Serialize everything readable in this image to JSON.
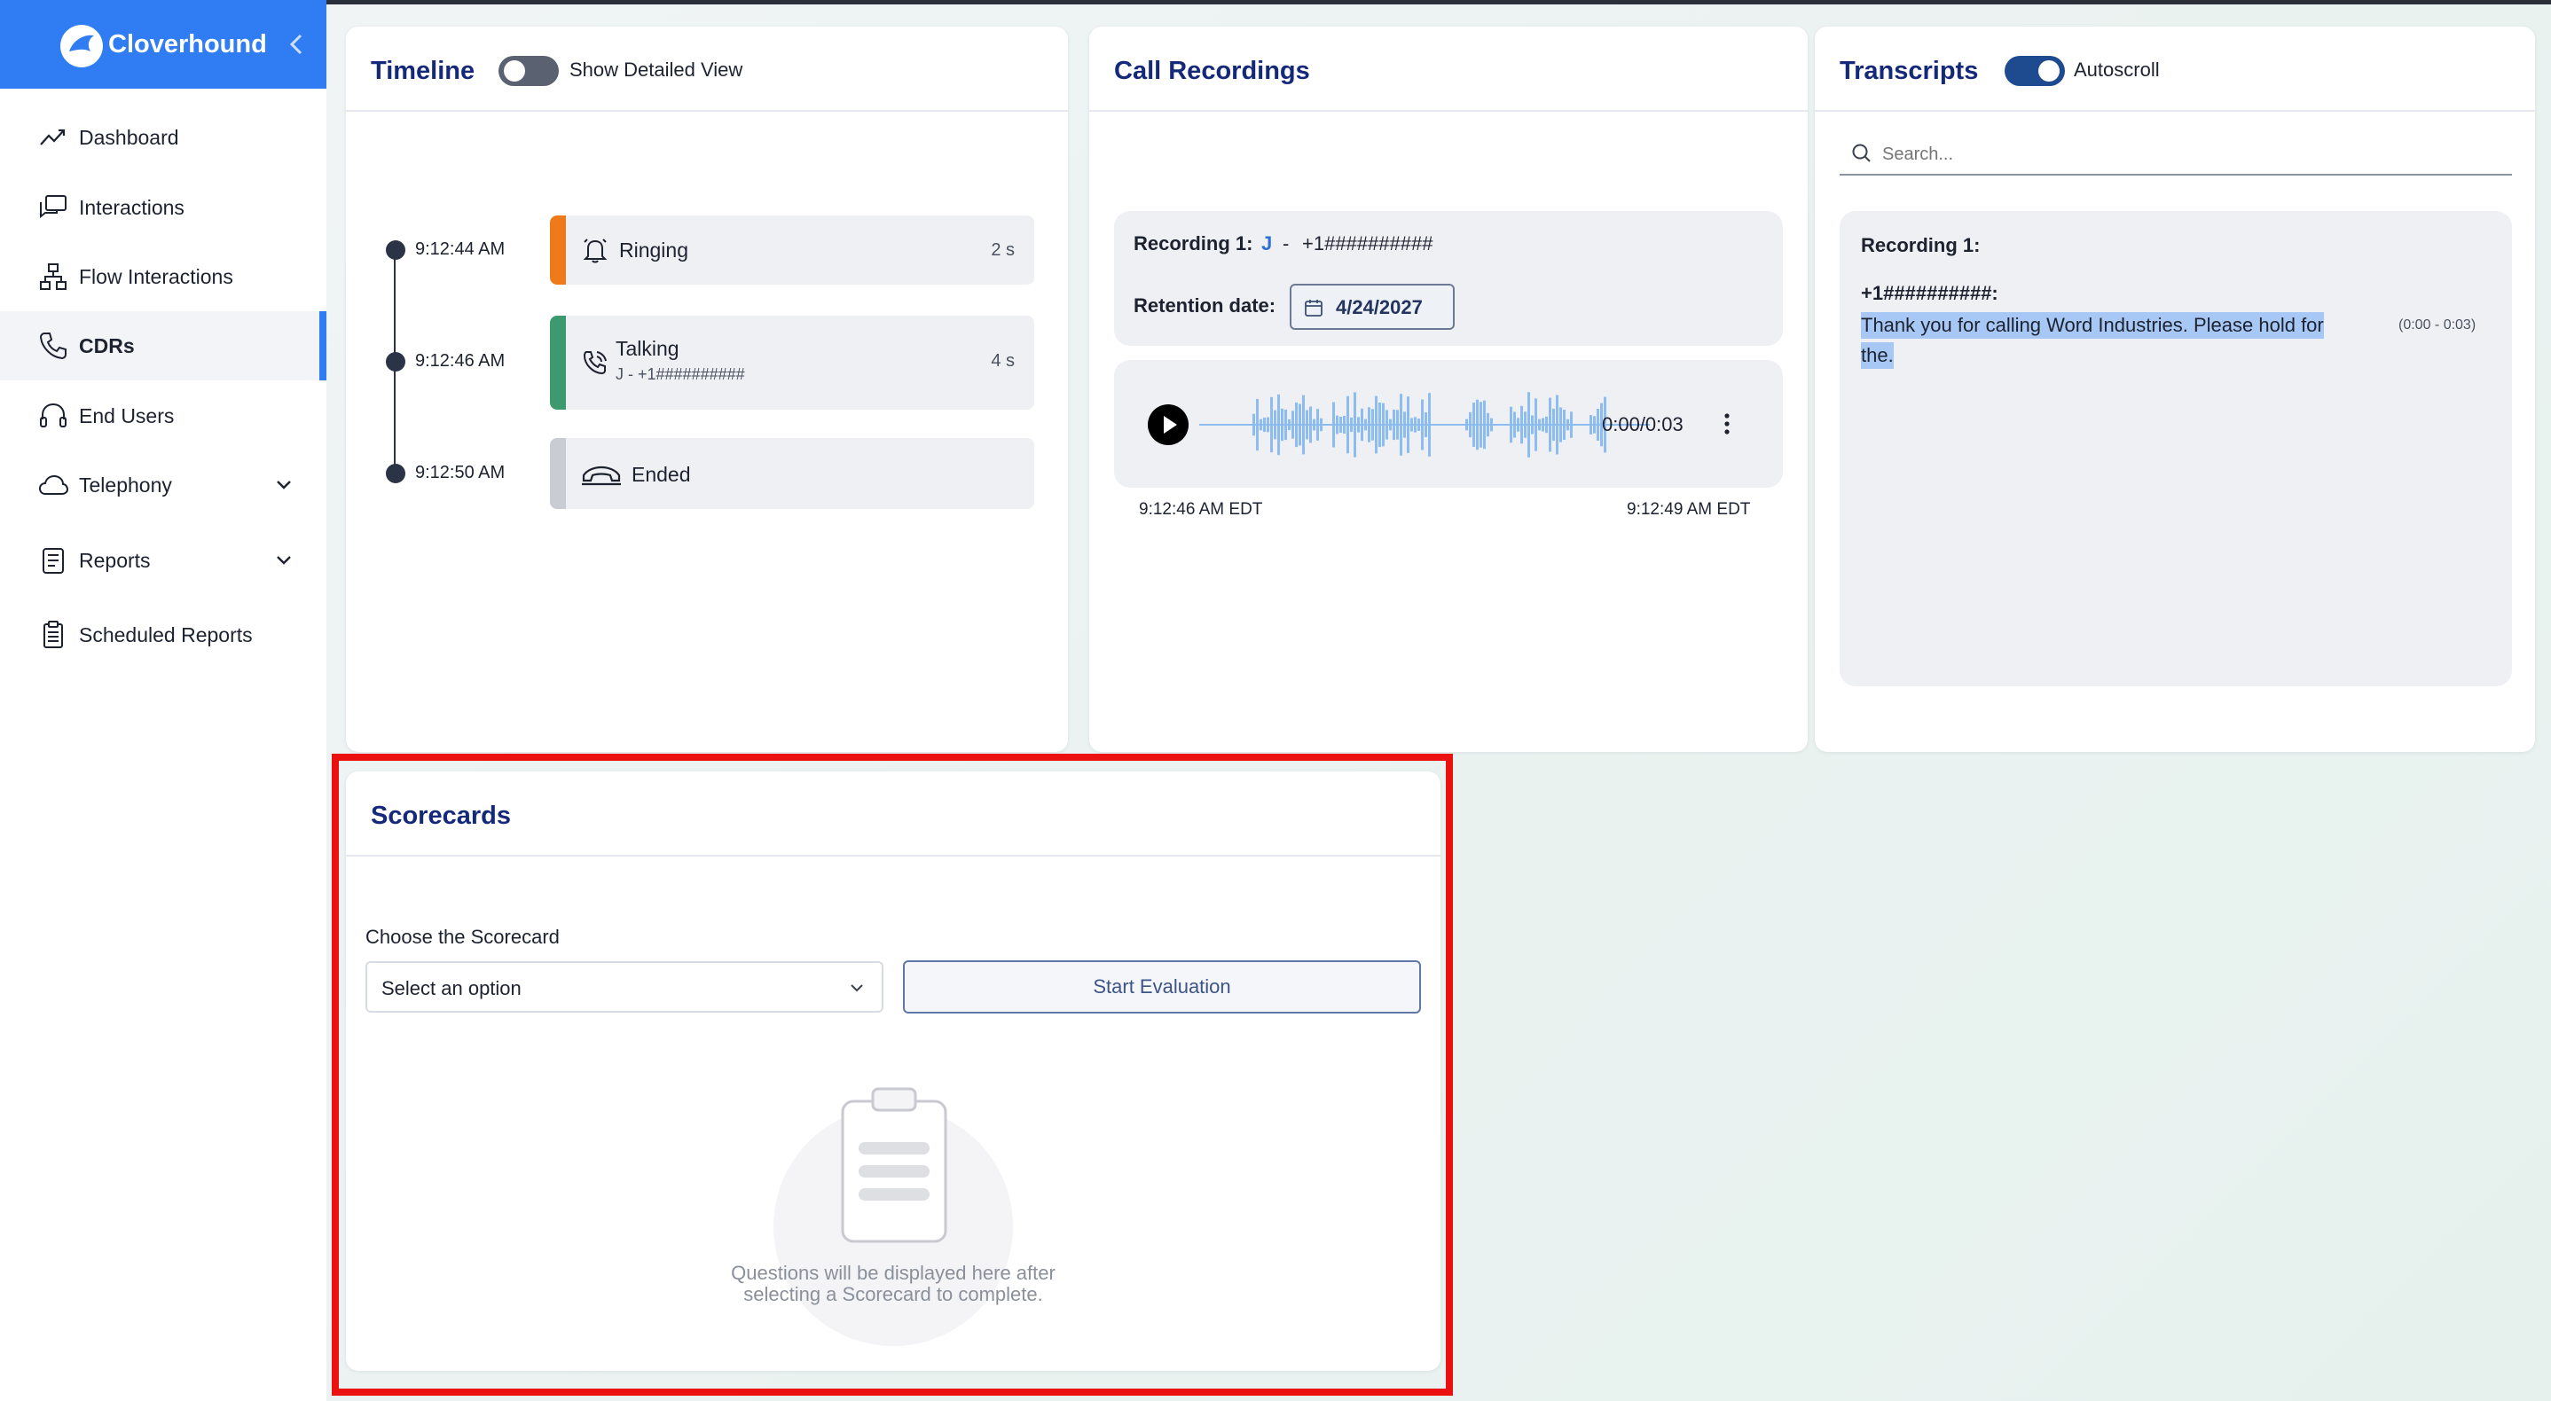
{
  "brand": {
    "name": "Cloverhound",
    "color": "#2f7cf3"
  },
  "sidebar": {
    "items": [
      {
        "label": "Dashboard",
        "icon": "trend-line-icon"
      },
      {
        "label": "Interactions",
        "icon": "chat-bubbles-icon"
      },
      {
        "label": "Flow Interactions",
        "icon": "flow-chart-icon"
      },
      {
        "label": "CDRs",
        "icon": "phone-icon",
        "active": true
      },
      {
        "label": "End Users",
        "icon": "headset-icon"
      },
      {
        "label": "Telephony",
        "icon": "cloud-icon",
        "expandable": true
      },
      {
        "label": "Reports",
        "icon": "report-phone-icon",
        "expandable": true
      },
      {
        "label": "Scheduled Reports",
        "icon": "clipboard-list-icon"
      }
    ]
  },
  "timeline": {
    "title": "Timeline",
    "toggle_label": "Show Detailed View",
    "toggle_on": false,
    "events": [
      {
        "time": "9:12:44 AM",
        "label": "Ringing",
        "sub": "",
        "duration": "2 s",
        "color": "#ee7a1a",
        "icon": "bell-icon"
      },
      {
        "time": "9:12:46 AM",
        "label": "Talking",
        "sub": "J - +1##########",
        "duration": "4 s",
        "color": "#3d9a6e",
        "icon": "phone-talking-icon"
      },
      {
        "time": "9:12:50 AM",
        "label": "Ended",
        "sub": "",
        "duration": "",
        "color": "#c9ccd3",
        "icon": "phone-hangup-icon"
      }
    ]
  },
  "recordings": {
    "title": "Call Recordings",
    "recording_label": "Recording 1:",
    "agent": "J",
    "separator": "-",
    "number": "+1##########",
    "retention_label": "Retention date:",
    "retention_date": "4/24/2027",
    "player_time": "0:00/0:03",
    "start_time": "9:12:46 AM EDT",
    "end_time": "9:12:49 AM EDT",
    "wave_color": "#8dbcf0"
  },
  "transcripts": {
    "title": "Transcripts",
    "toggle_label": "Autoscroll",
    "toggle_on": true,
    "search_placeholder": "Search...",
    "recording_label": "Recording 1:",
    "speaker": "+1##########:",
    "line1": "Thank you for calling Word Industries. Please hold for",
    "line2": "the.",
    "timestamp": "(0:00 - 0:03)"
  },
  "scorecards": {
    "title": "Scorecards",
    "choose_label": "Choose the Scorecard",
    "select_value": "Select an option",
    "button_label": "Start Evaluation",
    "empty_line1": "Questions will be displayed here after",
    "empty_line2": "selecting a Scorecard to complete."
  }
}
